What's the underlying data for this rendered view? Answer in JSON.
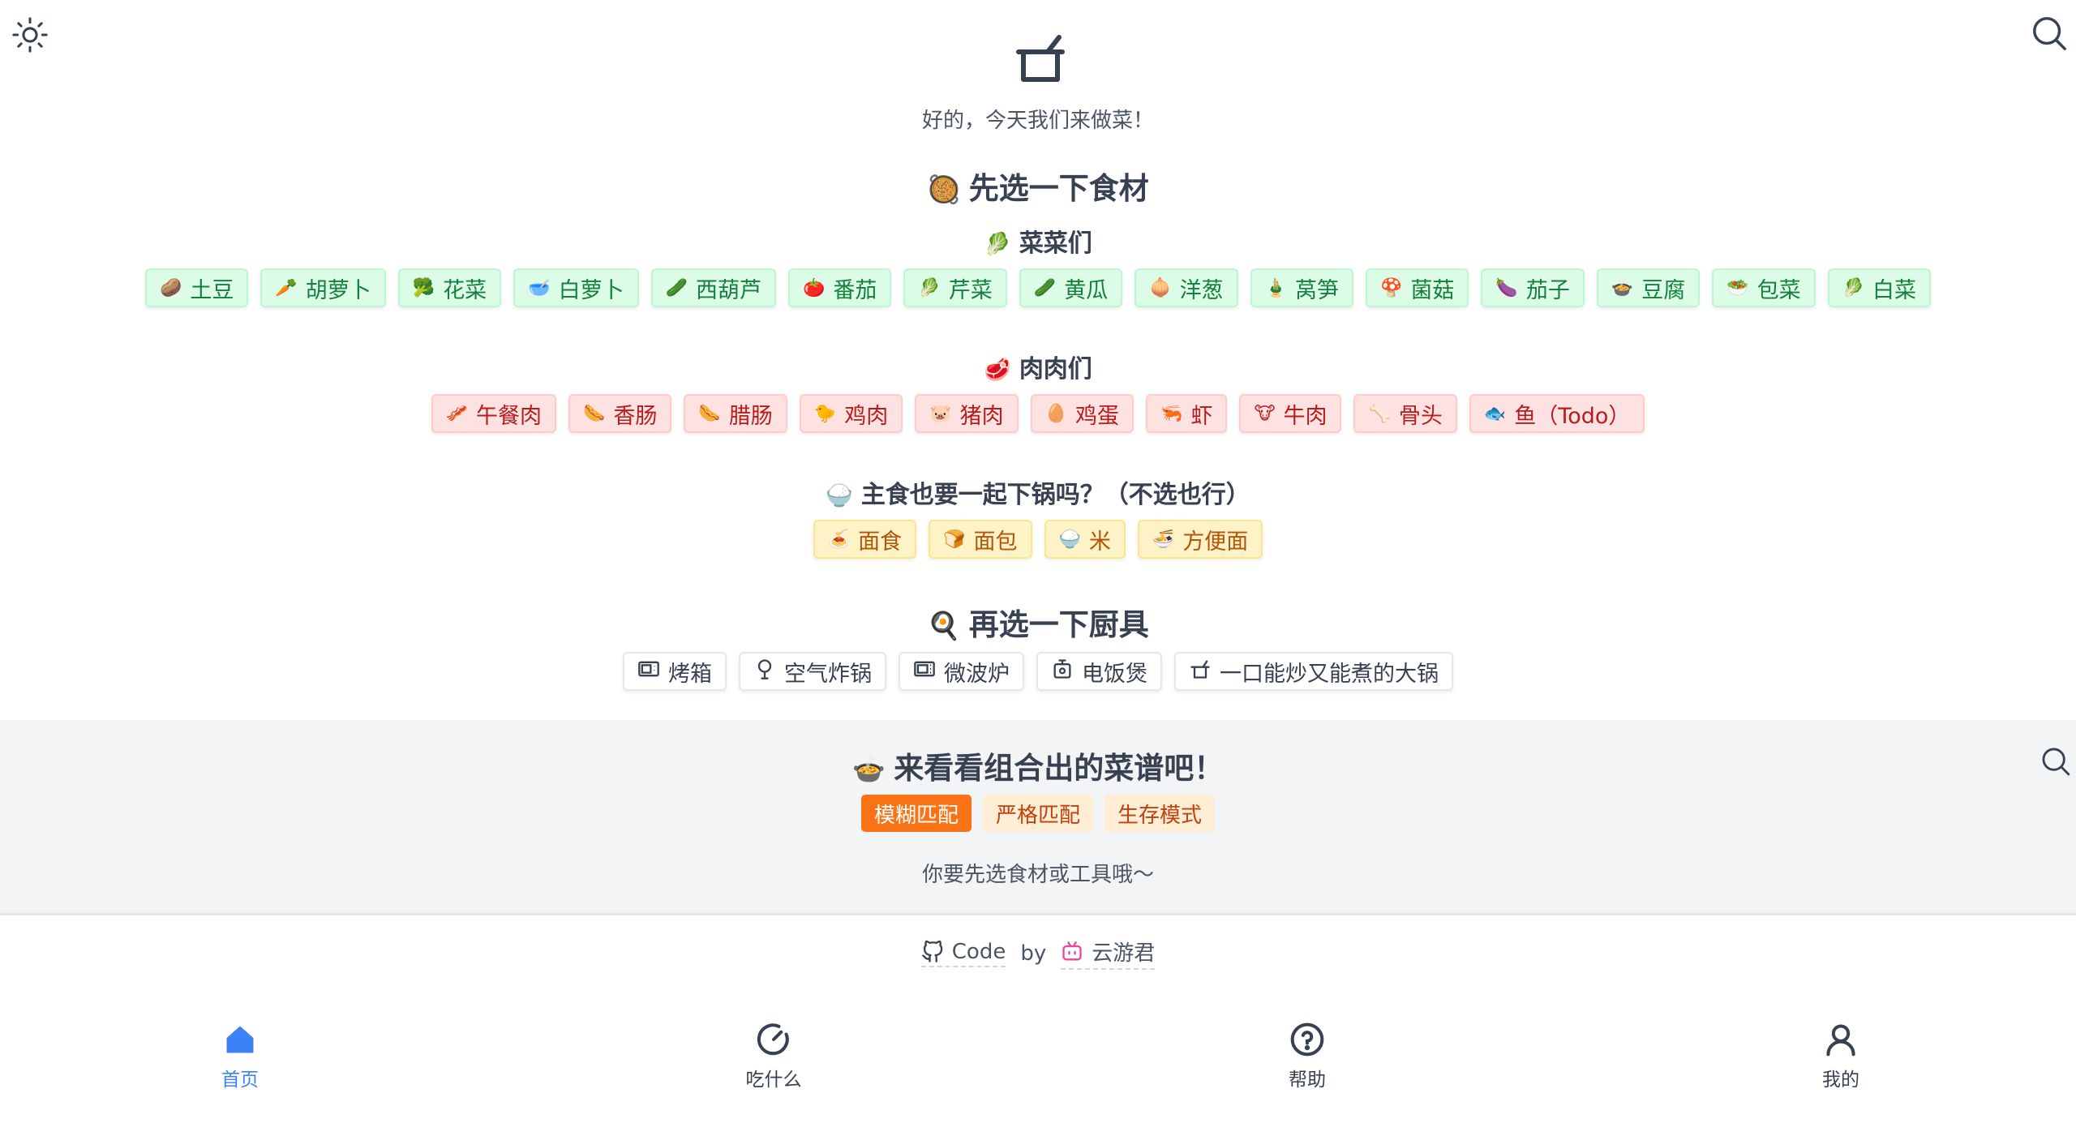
{
  "header": {
    "theme_icon": "sun-icon",
    "search_icon": "search-icon",
    "logo_icon": "pot-icon",
    "tagline": "好的，今天我们来做菜！"
  },
  "ingredients": {
    "title_emoji": "🥘",
    "title": "先选一下食材",
    "vegetables": {
      "emoji": "🥬",
      "title": "菜菜们",
      "items": [
        {
          "emoji": "🥔",
          "label": "土豆"
        },
        {
          "emoji": "🥕",
          "label": "胡萝卜"
        },
        {
          "emoji": "🥦",
          "label": "花菜"
        },
        {
          "emoji": "🥣",
          "label": "白萝卜"
        },
        {
          "emoji": "🥒",
          "label": "西葫芦"
        },
        {
          "emoji": "🍅",
          "label": "番茄"
        },
        {
          "emoji": "🥬",
          "label": "芹菜"
        },
        {
          "emoji": "🥒",
          "label": "黄瓜"
        },
        {
          "emoji": "🧅",
          "label": "洋葱"
        },
        {
          "emoji": "🎍",
          "label": "莴笋"
        },
        {
          "emoji": "🍄",
          "label": "菌菇"
        },
        {
          "emoji": "🍆",
          "label": "茄子"
        },
        {
          "emoji": "🍲",
          "label": "豆腐"
        },
        {
          "emoji": "🥗",
          "label": "包菜"
        },
        {
          "emoji": "🥬",
          "label": "白菜"
        }
      ]
    },
    "meats": {
      "emoji": "🥩",
      "title": "肉肉们",
      "items": [
        {
          "emoji": "🥓",
          "label": "午餐肉"
        },
        {
          "emoji": "🌭",
          "label": "香肠"
        },
        {
          "emoji": "🌭",
          "label": "腊肠"
        },
        {
          "emoji": "🐤",
          "label": "鸡肉"
        },
        {
          "emoji": "🐷",
          "label": "猪肉"
        },
        {
          "emoji": "🥚",
          "label": "鸡蛋"
        },
        {
          "emoji": "🦐",
          "label": "虾"
        },
        {
          "emoji": "🐮",
          "label": "牛肉"
        },
        {
          "emoji": "🦴",
          "label": "骨头"
        },
        {
          "emoji": "🐟",
          "label": "鱼（Todo）"
        }
      ]
    },
    "staples": {
      "emoji": "🍚",
      "title": "主食也要一起下锅吗？（不选也行）",
      "items": [
        {
          "emoji": "🍝",
          "label": "面食"
        },
        {
          "emoji": "🍞",
          "label": "面包"
        },
        {
          "emoji": "🍚",
          "label": "米"
        },
        {
          "emoji": "🍜",
          "label": "方便面"
        }
      ]
    }
  },
  "tools": {
    "emoji": "🍳",
    "title": "再选一下厨具",
    "items": [
      {
        "icon": "oven-icon",
        "label": "烤箱"
      },
      {
        "icon": "air-fryer-icon",
        "label": "空气炸锅"
      },
      {
        "icon": "microwave-icon",
        "label": "微波炉"
      },
      {
        "icon": "rice-cooker-icon",
        "label": "电饭煲"
      },
      {
        "icon": "wok-icon",
        "label": "一口能炒又能煮的大锅"
      }
    ]
  },
  "recipes": {
    "emoji": "🍲",
    "title": "来看看组合出的菜谱吧！",
    "modes": [
      "模糊匹配",
      "严格匹配",
      "生存模式"
    ],
    "active_mode": "模糊匹配",
    "hint": "你要先选食材或工具哦～",
    "search_icon": "search-icon"
  },
  "footer": {
    "code_label": "Code",
    "by_label": "by",
    "author": "云游君",
    "github_icon": "github-icon",
    "bilibili_icon": "bilibili-icon"
  },
  "tabbar": {
    "items": [
      {
        "icon": "home-icon",
        "label": "首页",
        "active": true
      },
      {
        "icon": "gauge-icon",
        "label": "吃什么",
        "active": false
      },
      {
        "icon": "help-icon",
        "label": "帮助",
        "active": false
      },
      {
        "icon": "user-icon",
        "label": "我的",
        "active": false
      }
    ]
  },
  "colors": {
    "accent": "#f97316",
    "veg": "#15803d",
    "meat": "#b91c1c",
    "staple": "#b45309",
    "tab_active": "#3b82f6"
  }
}
